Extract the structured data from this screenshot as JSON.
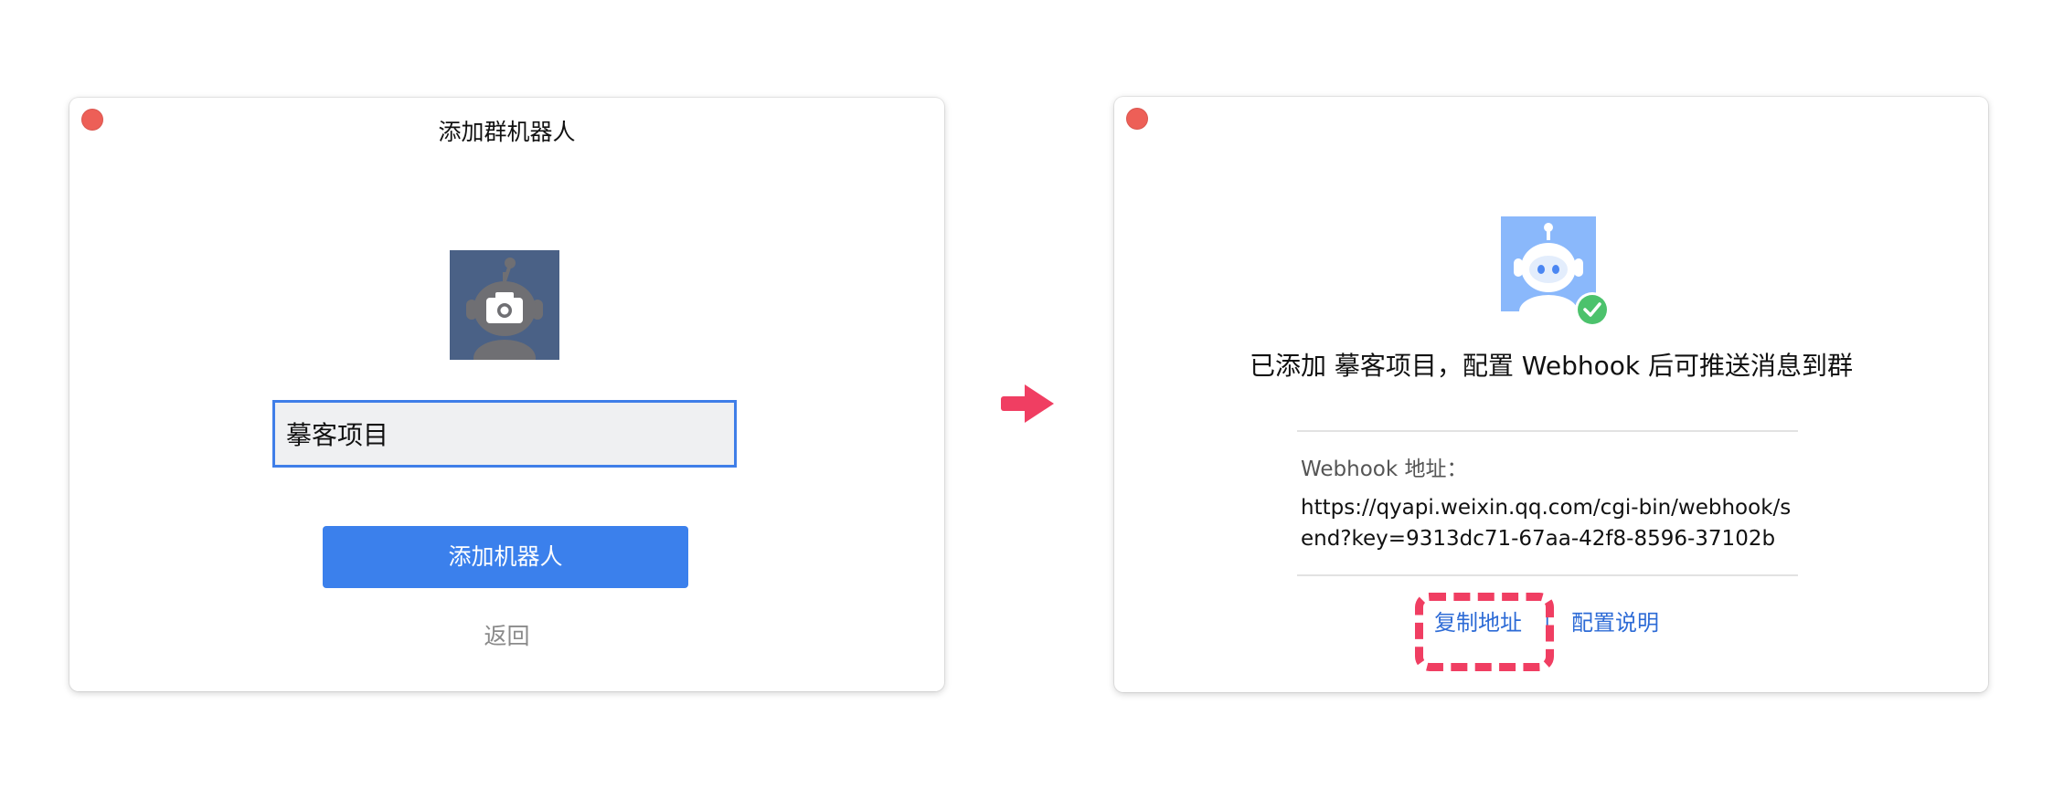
{
  "left_window": {
    "title": "添加群机器人",
    "name_value": "摹客项目",
    "add_button": "添加机器人",
    "back_link": "返回"
  },
  "right_window": {
    "success_message": "已添加 摹客项目，配置 Webhook 后可推送消息到群",
    "webhook_label": "Webhook 地址：",
    "webhook_url": "https://qyapi.weixin.qq.com/cgi-bin/webhook/send?key=9313dc71-67aa-42f8-8596-37102be…",
    "copy_link": "复制地址",
    "separator": "|",
    "config_link": "配置说明"
  },
  "colors": {
    "primary": "#3b80ec",
    "link": "#2d6bd6",
    "highlight": "#f03e62",
    "arrow": "#f03e62",
    "close_button": "#ed5f57",
    "success_check": "#4cc26c"
  },
  "icons": [
    "close-icon",
    "robot-camera-icon",
    "right-arrow-icon",
    "robot-icon",
    "check-badge-icon"
  ]
}
